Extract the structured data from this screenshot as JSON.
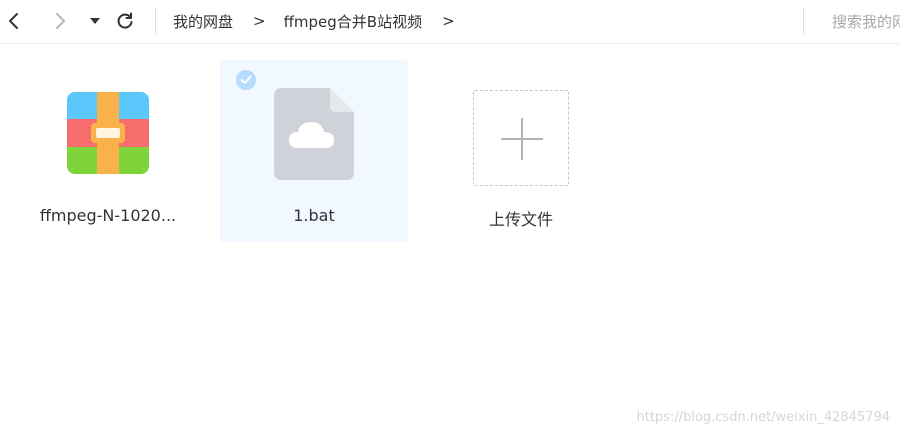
{
  "toolbar": {
    "back_icon": "chevron-left-icon",
    "forward_icon": "chevron-right-icon",
    "history_icon": "caret-down-icon",
    "refresh_icon": "refresh-icon"
  },
  "breadcrumb": {
    "root": "我的网盘",
    "separator": ">",
    "folder": "ffmpeg合并B站视频",
    "trailing_separator": ">"
  },
  "search": {
    "placeholder": "搜索我的网盘文件"
  },
  "files": [
    {
      "name": "ffmpeg-N-1020...",
      "icon": "archive-icon",
      "selected": false
    },
    {
      "name": "1.bat",
      "icon": "cloud-file-icon",
      "selected": true
    },
    {
      "name": "上传文件",
      "icon": "plus-icon",
      "selected": false
    }
  ],
  "watermark": "https://blog.csdn.net/weixin_42845794",
  "colors": {
    "selection_bg": "#f1f8ff",
    "check_badge": "#b5dbff",
    "archive_top": "#5ac8fa",
    "archive_mid": "#f76c6c",
    "archive_bottom": "#7ed43a",
    "archive_band": "#f9b24a"
  }
}
